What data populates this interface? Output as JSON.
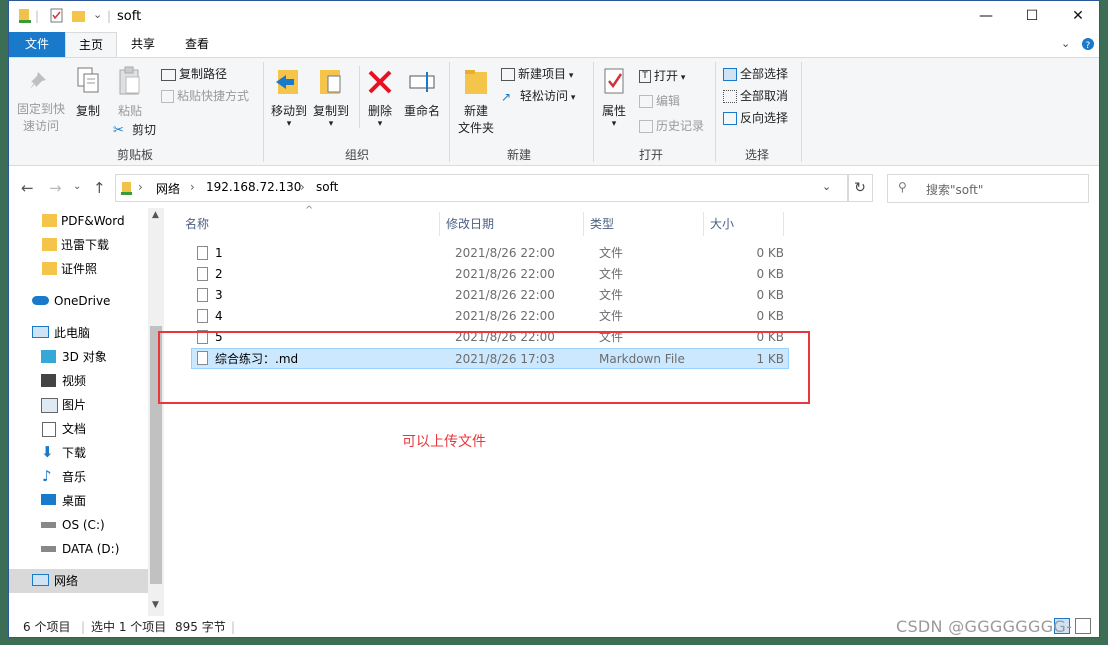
{
  "window": {
    "title": "soft",
    "controls": {
      "minimize": "—",
      "maximize": "☐",
      "close": "✕"
    }
  },
  "tabs": [
    "文件",
    "主页",
    "共享",
    "查看"
  ],
  "ribbon": {
    "clipboard": {
      "pin": "固定到快速访问",
      "pin_l1": "固定到快",
      "pin_l2": "速访问",
      "copy": "复制",
      "paste": "粘贴",
      "copy_path": "复制路径",
      "paste_shortcut": "粘贴快捷方式",
      "cut": "剪切",
      "group": "剪贴板"
    },
    "organize": {
      "move_to": "移动到",
      "copy_to": "复制到",
      "delete": "删除",
      "rename": "重命名",
      "group": "组织"
    },
    "new": {
      "new_folder_l1": "新建",
      "new_folder_l2": "文件夹",
      "new_item": "新建项目",
      "easy_access": "轻松访问",
      "group": "新建"
    },
    "open": {
      "properties": "属性",
      "open": "打开",
      "edit": "编辑",
      "history": "历史记录",
      "group": "打开"
    },
    "select": {
      "select_all": "全部选择",
      "select_none": "全部取消",
      "invert": "反向选择",
      "group": "选择"
    }
  },
  "address": {
    "crumbs": [
      "网络",
      "192.168.72.130",
      "soft"
    ],
    "search_placeholder": "搜索\"soft\""
  },
  "nav": {
    "quick": [
      "PDF&Word",
      "迅雷下载",
      "证件照"
    ],
    "onedrive": "OneDrive",
    "this_pc": "此电脑",
    "pc_items": [
      "3D 对象",
      "视频",
      "图片",
      "文档",
      "下载",
      "音乐",
      "桌面",
      "OS (C:)",
      "DATA (D:)"
    ],
    "network": "网络"
  },
  "columns": {
    "name": "名称",
    "modified": "修改日期",
    "type": "类型",
    "size": "大小"
  },
  "files": [
    {
      "name": "1",
      "modified": "2021/8/26 22:00",
      "type": "文件",
      "size": "0 KB"
    },
    {
      "name": "2",
      "modified": "2021/8/26 22:00",
      "type": "文件",
      "size": "0 KB"
    },
    {
      "name": "3",
      "modified": "2021/8/26 22:00",
      "type": "文件",
      "size": "0 KB"
    },
    {
      "name": "4",
      "modified": "2021/8/26 22:00",
      "type": "文件",
      "size": "0 KB"
    },
    {
      "name": "5",
      "modified": "2021/8/26 22:00",
      "type": "文件",
      "size": "0 KB"
    },
    {
      "name": "综合练习：.md",
      "modified": "2021/8/26 17:03",
      "type": "Markdown File",
      "size": "1 KB"
    }
  ],
  "annotation": "可以上传文件",
  "status": {
    "count": "6 个项目",
    "selected": "选中 1 个项目",
    "size": "895 字节"
  },
  "watermark": "CSDN @GGGGGGGG-",
  "colors": {
    "accent": "#1979ca",
    "selection": "#cce8ff",
    "annotation": "#e8383d"
  }
}
